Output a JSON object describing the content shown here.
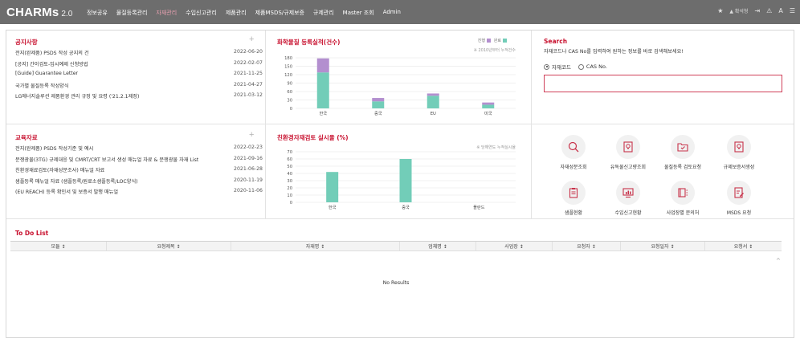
{
  "app": {
    "name": "CHARMs",
    "version": "2.0"
  },
  "nav": {
    "items": [
      {
        "label": "정보공유",
        "active": false
      },
      {
        "label": "물질등록관리",
        "active": false
      },
      {
        "label": "자재관리",
        "active": true
      },
      {
        "label": "수입신고관리",
        "active": false
      },
      {
        "label": "제품관리",
        "active": false
      },
      {
        "label": "제품MSDS/규제보증",
        "active": false
      },
      {
        "label": "규제관리",
        "active": false
      },
      {
        "label": "Master 조회",
        "active": false
      },
      {
        "label": "Admin",
        "active": false
      }
    ],
    "right": {
      "star": "★",
      "user": "▲ 확석형",
      "logout": "⇥",
      "sitemap": "⚠",
      "font": "A",
      "menu": "☰"
    },
    "icons": [
      "star-icon",
      "user-icon",
      "logout-icon",
      "sitemap-icon",
      "font-size-icon",
      "hamburger-menu-icon"
    ]
  },
  "notice": {
    "title": "공지사항",
    "more": "+",
    "items": [
      {
        "text": "전지(완제품) PSDS 작성 공지의 건",
        "date": "2022-06-20"
      },
      {
        "text": "[공지] 간이검토-임시예제 신청방법",
        "date": "2022-02-07"
      },
      {
        "text": "[Guide] Guarantee Letter",
        "date": "2021-11-25"
      },
      {
        "text": "국가별 물질등록 작성양식",
        "date": "2021-04-27"
      },
      {
        "text": "LG에너지솔루션 제품환경 관리 규정 및 요령 ('21.2.1제정)",
        "date": "2021-03-12"
      }
    ]
  },
  "education": {
    "title": "교육자료",
    "more": "+",
    "items": [
      {
        "text": "전지(완제품) PSDS 작성기준 및 예시",
        "date": "2022-02-23"
      },
      {
        "text": "분쟁광물(3TG) 규제대응 및 CMRT/CRT 보고서 생성 매뉴얼 자료 & 분쟁광물 자재 List",
        "date": "2021-09-16"
      },
      {
        "text": "친환경재료검토(자재성분조사) 매뉴얼 자료",
        "date": "2021-06-28"
      },
      {
        "text": "샘플등록 매뉴얼 자료 (샘플등록/원료소샘플등록/LOC양식)",
        "date": "2020-11-19"
      },
      {
        "text": "(EU REACH) 등록 확인서 및 보증서 발행 매뉴얼",
        "date": "2020-11-06"
      }
    ]
  },
  "chart1": {
    "title": "화학물질 등록실적(건수)",
    "legend": [
      "진행",
      "완료"
    ],
    "note": "※ 2010년부터 누적건수",
    "colors": {
      "done": "#72cdb8",
      "progress": "#b38fcf"
    }
  },
  "chart2": {
    "title": "친환경자재검토 실시율 (%)",
    "note": "※ 당해연도 누적실시율",
    "color": "#72cdb8"
  },
  "chart_data": [
    {
      "type": "bar",
      "title": "화학물질 등록실적(건수)",
      "categories": [
        "한국",
        "중국",
        "EU",
        "미국"
      ],
      "series": [
        {
          "name": "완료",
          "values": [
            128,
            25,
            45,
            13
          ]
        },
        {
          "name": "진행",
          "values": [
            50,
            12,
            8,
            8
          ]
        }
      ],
      "stacked": true,
      "ylim": [
        0,
        180
      ],
      "yticks": [
        0,
        30,
        60,
        90,
        120,
        150,
        180
      ],
      "grid": true,
      "legend": "top-right"
    },
    {
      "type": "bar",
      "title": "친환경자재검토 실시율 (%)",
      "categories": [
        "한국",
        "중국",
        "폴란드"
      ],
      "values": [
        42,
        60,
        0
      ],
      "ylim": [
        0,
        70
      ],
      "yticks": [
        0,
        10,
        20,
        30,
        40,
        50,
        60,
        70
      ],
      "grid": true
    }
  ],
  "search": {
    "title": "Search",
    "desc": "자재코드나 CAS No를 입력하여 원하는 정보를 바로 검색해보세요!",
    "options": [
      {
        "label": "자재코드",
        "selected": true
      },
      {
        "label": "CAS No.",
        "selected": false
      }
    ],
    "value": "",
    "placeholder": ""
  },
  "quick_menu": [
    {
      "label": "자재성분조회",
      "icon": "search-magnifier-icon"
    },
    {
      "label": "유독물신고량조회",
      "icon": "bulb-document-icon"
    },
    {
      "label": "물질등록 검토요청",
      "icon": "folder-check-icon"
    },
    {
      "label": "규제보증서생성",
      "icon": "bulb-document-icon"
    },
    {
      "label": "샘플현황",
      "icon": "clipboard-list-icon"
    },
    {
      "label": "수입신고현황",
      "icon": "bar-chart-monitor-icon"
    },
    {
      "label": "사업장별 문의처",
      "icon": "book-icon"
    },
    {
      "label": "MSDS 요청",
      "icon": "document-edit-icon"
    }
  ],
  "todo": {
    "title": "To Do List",
    "columns": [
      "모듈 ↕",
      "요청제목 ↕",
      "자재명 ↕",
      "업체명 ↕",
      "사업장 ↕",
      "요청자 ↕",
      "요청일자 ↕",
      "요청서 ↕"
    ],
    "empty_text": "No Results",
    "scroll_up": "^"
  }
}
